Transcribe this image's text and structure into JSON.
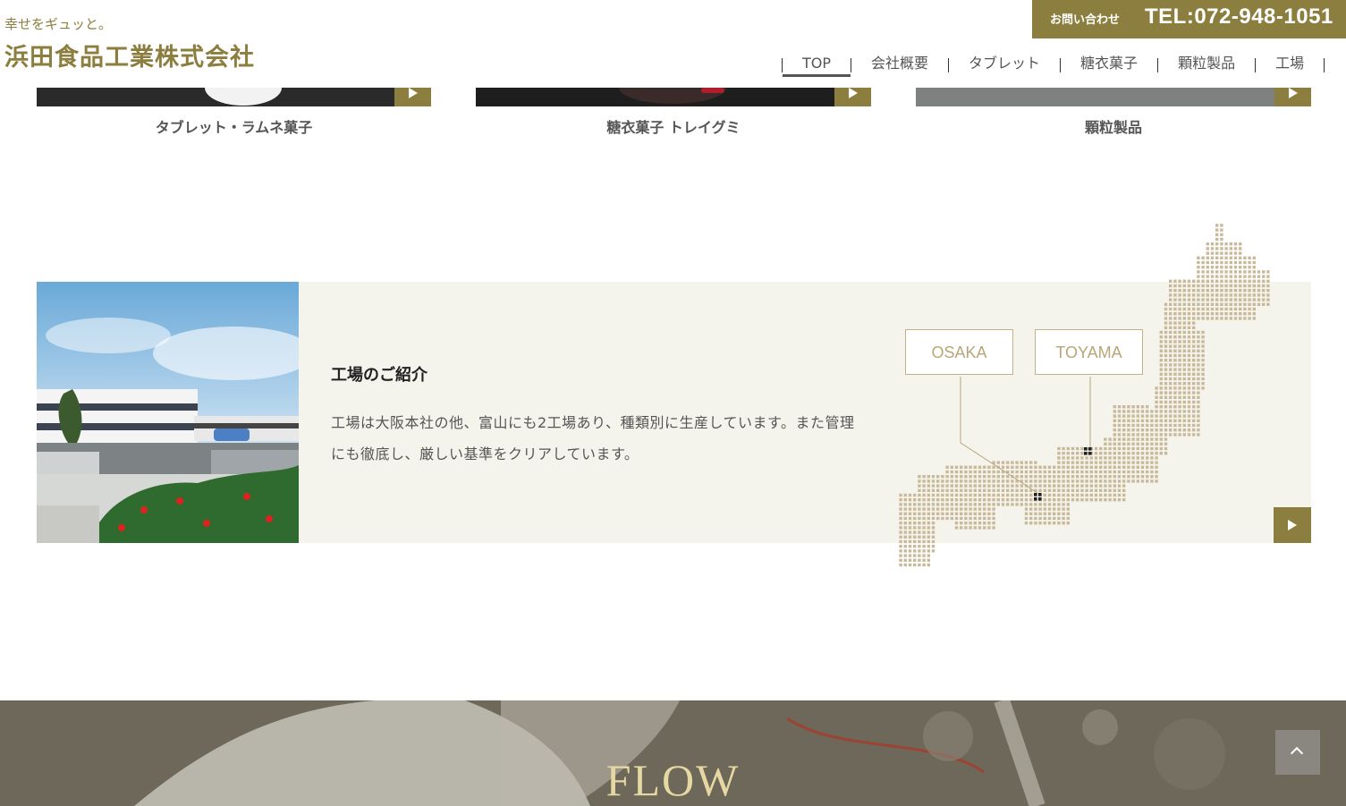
{
  "header": {
    "tagline": "幸せをギュッと。",
    "company_name": "浜田食品工業株式会社",
    "contact_label": "お問い合わせ",
    "tel": "TEL:072-948-1051"
  },
  "nav": [
    {
      "label": "TOP",
      "active": true
    },
    {
      "label": "会社概要"
    },
    {
      "label": "タブレット"
    },
    {
      "label": "糖衣菓子"
    },
    {
      "label": "顆粒製品"
    },
    {
      "label": "工場"
    }
  ],
  "products": [
    {
      "label": "タブレット・ラムネ菓子"
    },
    {
      "label": "糖衣菓子 トレイグミ"
    },
    {
      "label": "顆粒製品"
    }
  ],
  "factory": {
    "title": "工場のご紹介",
    "text": "工場は大阪本社の他、富山にも2工場あり、種類別に生産しています。また管理にも徹底し、厳しい基準をクリアしています。",
    "map_labels": [
      "OSAKA",
      "TOYAMA"
    ]
  },
  "flow": {
    "title": "FLOW"
  },
  "colors": {
    "accent": "#8b7e3e",
    "map_dot": "#c9b99a",
    "section_bg": "#f5f4ec"
  }
}
